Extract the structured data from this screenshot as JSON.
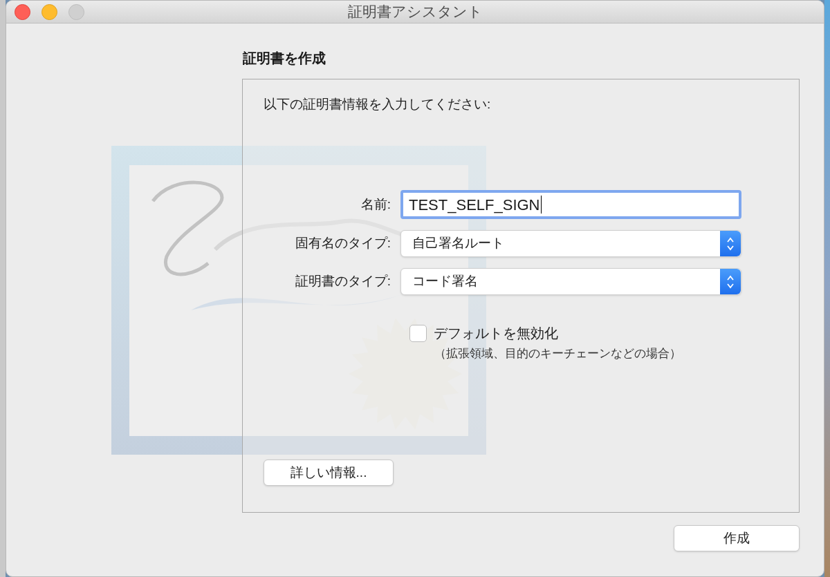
{
  "window": {
    "title": "証明書アシスタント"
  },
  "heading": "証明書を作成",
  "instruction": "以下の証明書情報を入力してください:",
  "fields": [
    {
      "kind": "input",
      "label": "名前:",
      "value": "TEST_SELF_SIGN",
      "focused": true
    },
    {
      "kind": "select",
      "label": "固有名のタイプ:",
      "value": "自己署名ルート"
    },
    {
      "kind": "select",
      "label": "証明書のタイプ:",
      "value": "コード署名"
    }
  ],
  "override_defaults": {
    "label": "デフォルトを無効化",
    "note": "（拡張領域、目的のキーチェーンなどの場合）",
    "checked": false
  },
  "details_button": "詳しい情報...",
  "create_button": "作成"
}
